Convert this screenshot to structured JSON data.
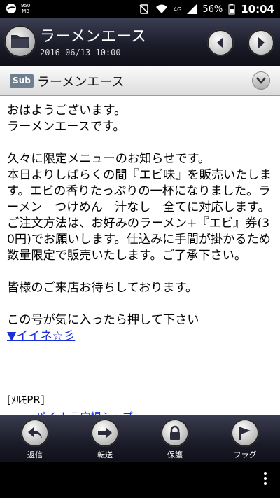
{
  "status_bar": {
    "data_amount": "950",
    "data_unit": "MB",
    "network": "4G",
    "battery": "56%",
    "time": "10:04"
  },
  "header": {
    "title": "ラーメンエース",
    "date": "2016 06/13 10:00"
  },
  "subject": {
    "badge": "Sub",
    "title": "ラーメンエース"
  },
  "message": {
    "body": "おはようございます。\nラーメンエースです。\n\n久々に限定メニューのお知らせです。\n本日よりしばらくの間『エビ味』を販売いたします。エビの香りたっぷりの一杯になりました。ラーメン　つけめん　汁なし　全てに対応します。ご注文方法は、お好みのラーメン+『エビ』券(30円)でお願いします。仕込みに手間が掛かるため数量限定で販売いたします。ご了承下さい。\n\n皆様のご来店お待ちしております。\n\nこの号が気に入ったら押して下さい",
    "like_link": "▼イイネ☆彡",
    "pr_label": "[ﾒﾙﾓPR]",
    "pr_cut_text": "ーッパイ トラ宝場シップ"
  },
  "toolbar": {
    "reply": "返信",
    "forward": "転送",
    "protect": "保護",
    "flag": "フラグ"
  },
  "colors": {
    "link": "#1a2fd6",
    "header_bg": "#1c1d2a"
  }
}
